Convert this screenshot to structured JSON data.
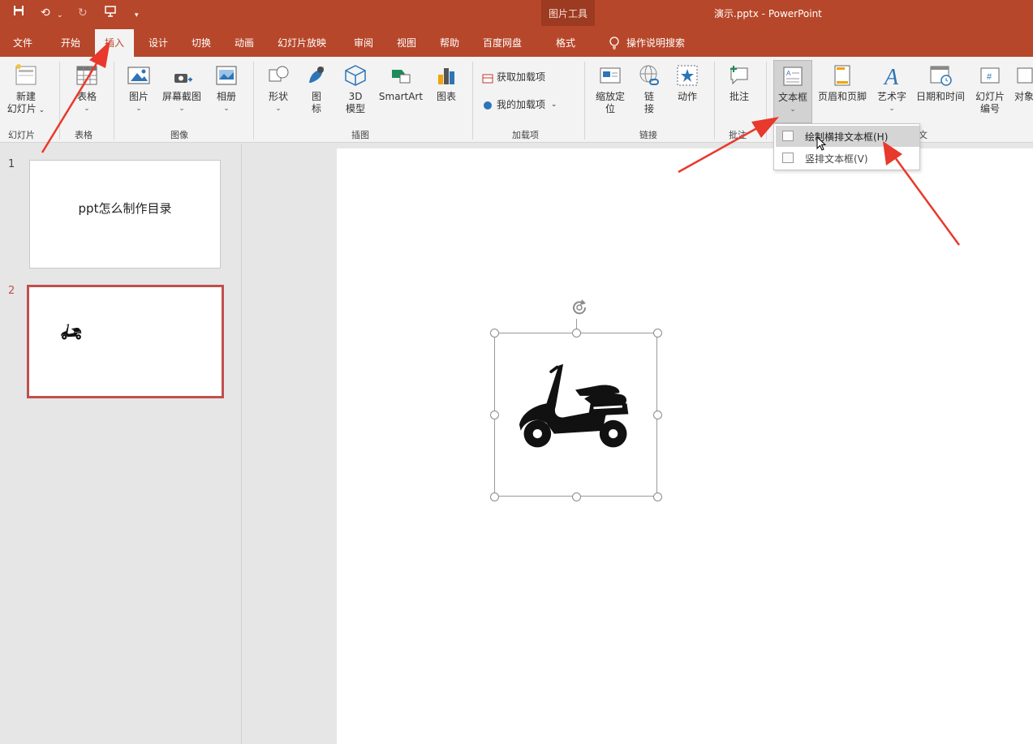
{
  "window": {
    "document_title": "演示.pptx - PowerPoint",
    "contextual_group": "图片工具"
  },
  "tabs": [
    "文件",
    "开始",
    "插入",
    "设计",
    "切换",
    "动画",
    "幻灯片放映",
    "审阅",
    "视图",
    "帮助",
    "百度网盘",
    "格式"
  ],
  "active_tab": "插入",
  "tell_me": "操作说明搜索",
  "ribbon": {
    "new_slide": "新建\n幻灯片",
    "table": "表格",
    "picture": "图片",
    "screenshot": "屏幕截图",
    "album": "相册",
    "shape": "形状",
    "icons": "图\n标",
    "model3d": "3D\n模型",
    "smartart": "SmartArt",
    "chart": "图表",
    "get_addins": "获取加载项",
    "my_addins": "我的加载项",
    "zoom": "缩放定\n位",
    "link": "链\n接",
    "action": "动作",
    "comment": "批注",
    "textbox": "文本框",
    "header_footer": "页眉和页脚",
    "wordart": "艺术字",
    "datetime": "日期和时间",
    "slide_number": "幻灯片\n编号",
    "object": "对象",
    "groups": {
      "slides": "幻灯片",
      "tables": "表格",
      "images": "图像",
      "illustrations": "插图",
      "addins": "加载项",
      "links": "链接",
      "comments": "批注",
      "text_trunc": "文"
    }
  },
  "dropdown": {
    "horizontal": "绘制横排文本框(H)",
    "vertical": "竖排文本框(V)"
  },
  "slides": [
    {
      "number": "1",
      "text": "ppt怎么制作目录"
    },
    {
      "number": "2",
      "text": ""
    }
  ],
  "colors": {
    "brand": "#b7472a",
    "arrow": "#e8392c",
    "selected_thumb": "#c0504d"
  }
}
